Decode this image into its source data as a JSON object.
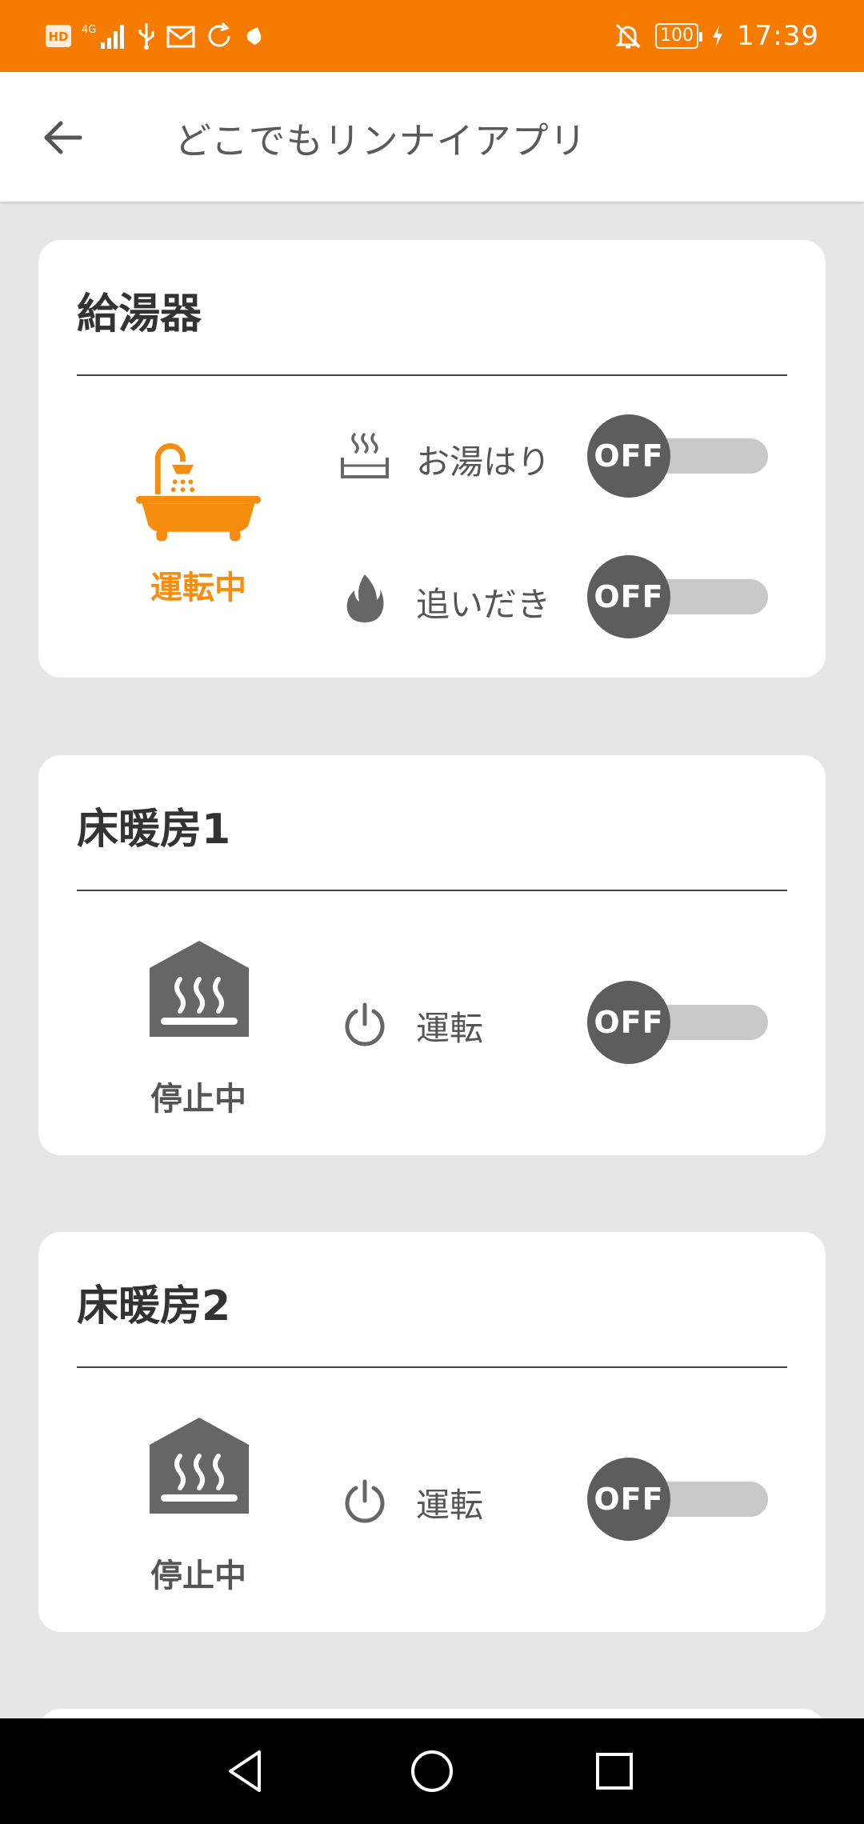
{
  "colors": {
    "status_bar": "#f57c00",
    "accent": "#f58d0e",
    "toggle_off": "#5d5d5d",
    "toggle_track": "#c9c9c9",
    "background": "#e6e6e6"
  },
  "status_bar": {
    "time": "17:39",
    "battery": "100",
    "network": "4G",
    "hd_badge": "HD",
    "icons": [
      "hd-icon",
      "signal-icon",
      "usb-icon",
      "mail-icon",
      "sync-icon",
      "weather-icon",
      "mute-icon",
      "charging-icon"
    ]
  },
  "app_bar": {
    "title": "どこでもリンナイアプリ"
  },
  "cards": {
    "water_heater": {
      "title": "給湯器",
      "status": "運転中",
      "controls": {
        "bath_fill": {
          "label": "お湯はり",
          "toggle": "OFF"
        },
        "reheat": {
          "label": "追いだき",
          "toggle": "OFF"
        }
      }
    },
    "floor_heating_1": {
      "title": "床暖房1",
      "status": "停止中",
      "control": {
        "label": "運転",
        "toggle": "OFF"
      }
    },
    "floor_heating_2": {
      "title": "床暖房2",
      "status": "停止中",
      "control": {
        "label": "運転",
        "toggle": "OFF"
      }
    }
  },
  "nav_bar": {
    "icons": [
      "back-triangle-icon",
      "home-circle-icon",
      "recents-square-icon"
    ]
  }
}
